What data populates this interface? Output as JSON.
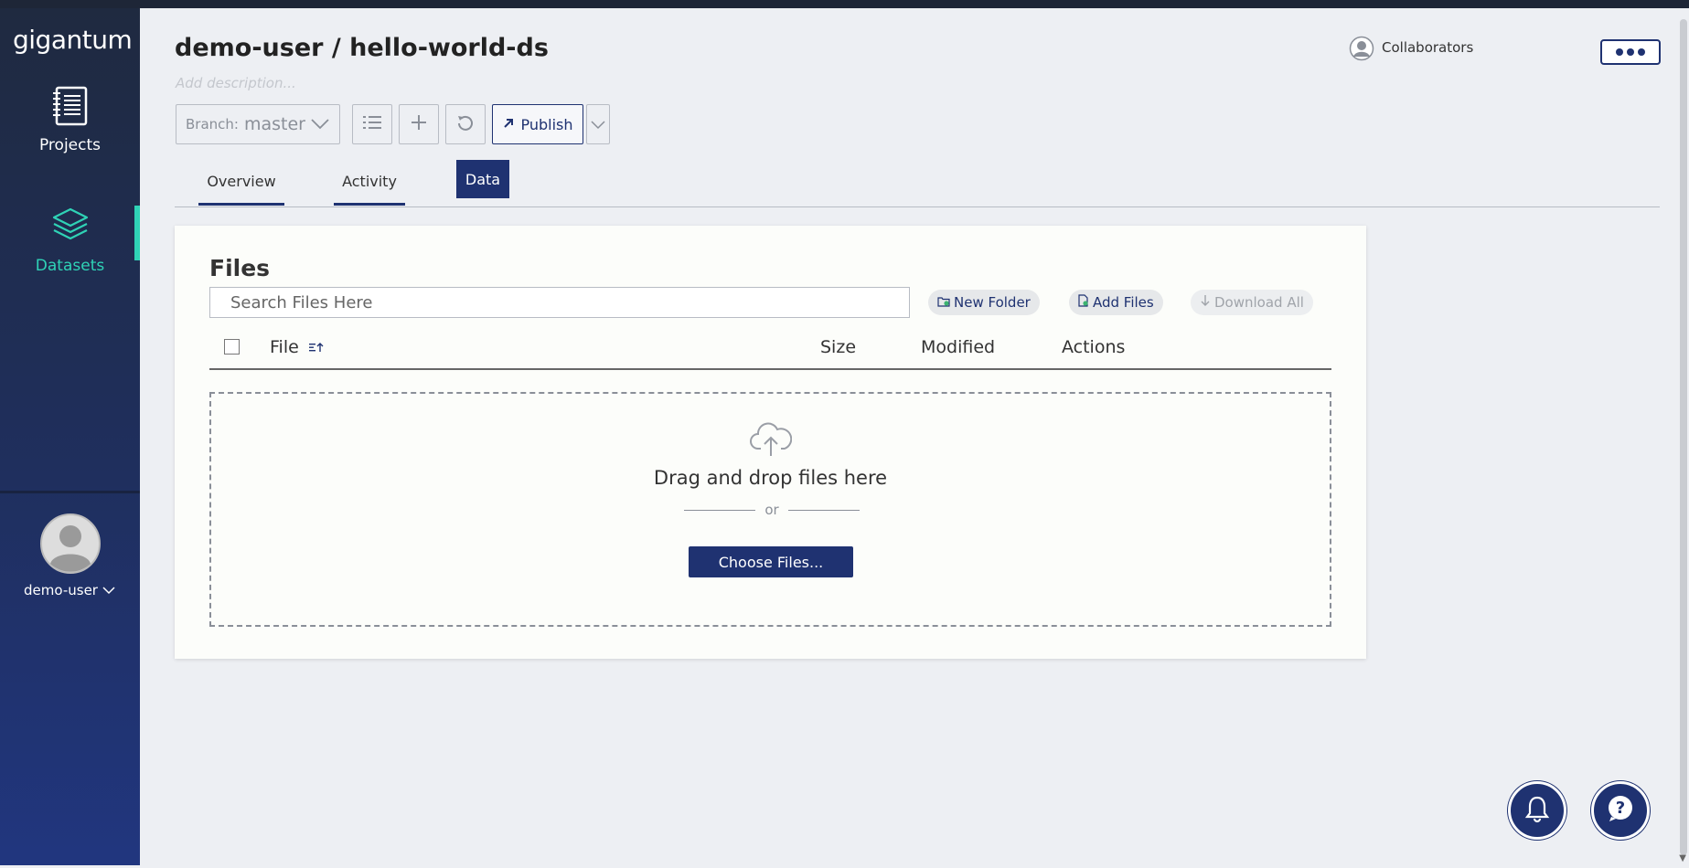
{
  "sidebar": {
    "logo": "gigantum",
    "items": [
      {
        "label": "Projects",
        "icon": "notebook-icon"
      },
      {
        "label": "Datasets",
        "icon": "layers-icon",
        "active": true
      }
    ],
    "user": {
      "name": "demo-user"
    }
  },
  "header": {
    "title": "demo-user / hello-world-ds",
    "description_placeholder": "Add description...",
    "collaborators_label": "Collaborators"
  },
  "toolbar": {
    "branch_prefix": "Branch:",
    "branch_name": "master",
    "publish_label": "Publish"
  },
  "tabs": [
    {
      "label": "Overview"
    },
    {
      "label": "Activity"
    },
    {
      "label": "Data",
      "active": true
    }
  ],
  "files": {
    "title": "Files",
    "search_placeholder": "Search Files Here",
    "new_folder_label": "New Folder",
    "add_files_label": "Add Files",
    "download_all_label": "Download All",
    "columns": [
      "File",
      "Size",
      "Modified",
      "Actions"
    ],
    "dropzone_text": "Drag and drop files here",
    "or_text": "or",
    "choose_files_label": "Choose Files..."
  },
  "colors": {
    "accent": "#1f3271",
    "active_nav": "#2fd3b6",
    "sidebar_bg": "#1f2a40"
  }
}
